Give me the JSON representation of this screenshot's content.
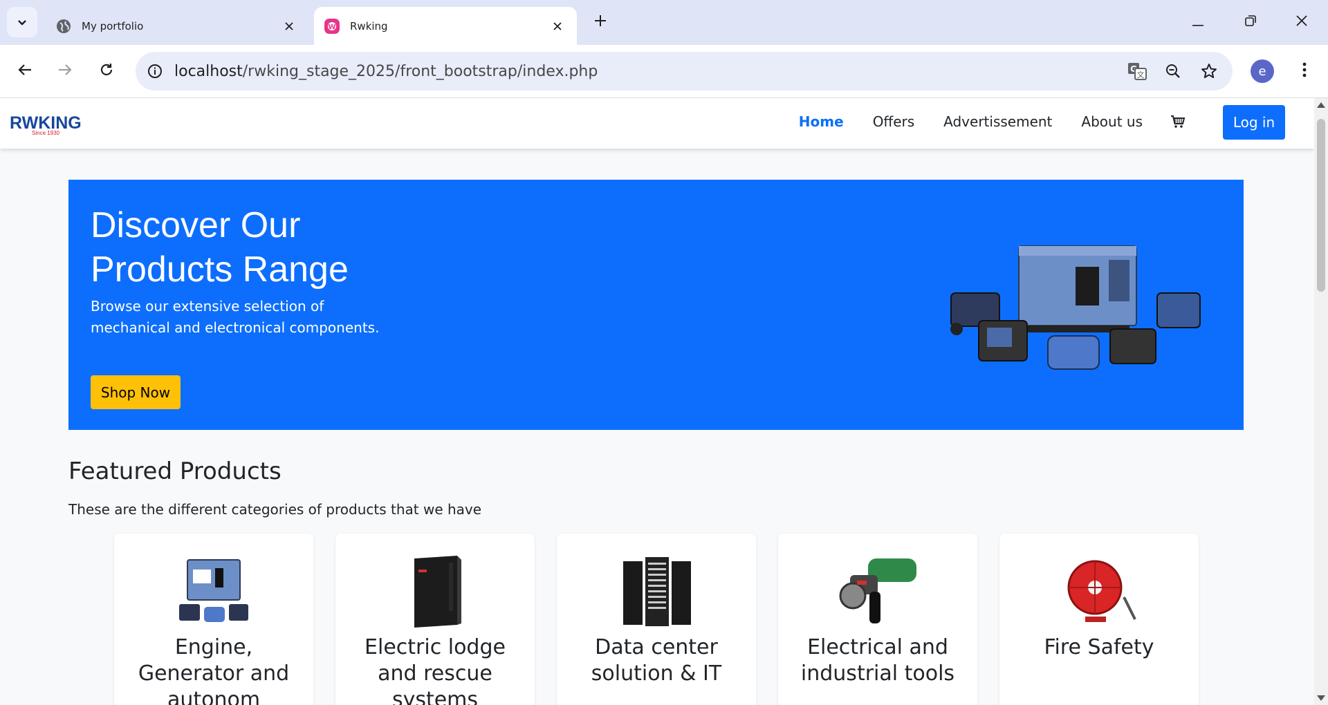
{
  "browser": {
    "tabs": [
      {
        "title": "My portfolio",
        "active": false
      },
      {
        "title": "Rwking",
        "active": true
      }
    ],
    "url_host": "localhost",
    "url_path": "/rwking_stage_2025/front_bootstrap/index.php",
    "profile_initial": "e"
  },
  "navbar": {
    "logo_text": "RWKING",
    "logo_since": "Since 1930",
    "links": [
      "Home",
      "Offers",
      "Advertissement",
      "About us"
    ],
    "active_link": "Home",
    "login_label": "Log in"
  },
  "hero": {
    "title": "Discover Our Products Range",
    "subtitle": "Browse our extensive selection of mechanical and electronical components.",
    "button_label": "Shop Now"
  },
  "featured": {
    "title": "Featured Products",
    "subtitle": "These are the different categories of products that we have",
    "categories": [
      "Engine, Generator and autonom",
      "Electric lodge and rescue systems",
      "Data center solution & IT",
      "Electrical and industrial tools",
      "Fire Safety"
    ]
  },
  "colors": {
    "primary": "#0d6efd",
    "warning": "#ffc107",
    "tabstrip": "#dfe4f7"
  },
  "icons": [
    "search-tabs-icon",
    "globe-icon",
    "rwking-favicon",
    "close-icon",
    "plus-icon",
    "minimize-icon",
    "restore-icon",
    "close-window-icon",
    "back-icon",
    "forward-icon",
    "reload-icon",
    "info-icon",
    "translate-icon",
    "zoom-icon",
    "star-icon",
    "kebab-icon",
    "cart-icon"
  ]
}
